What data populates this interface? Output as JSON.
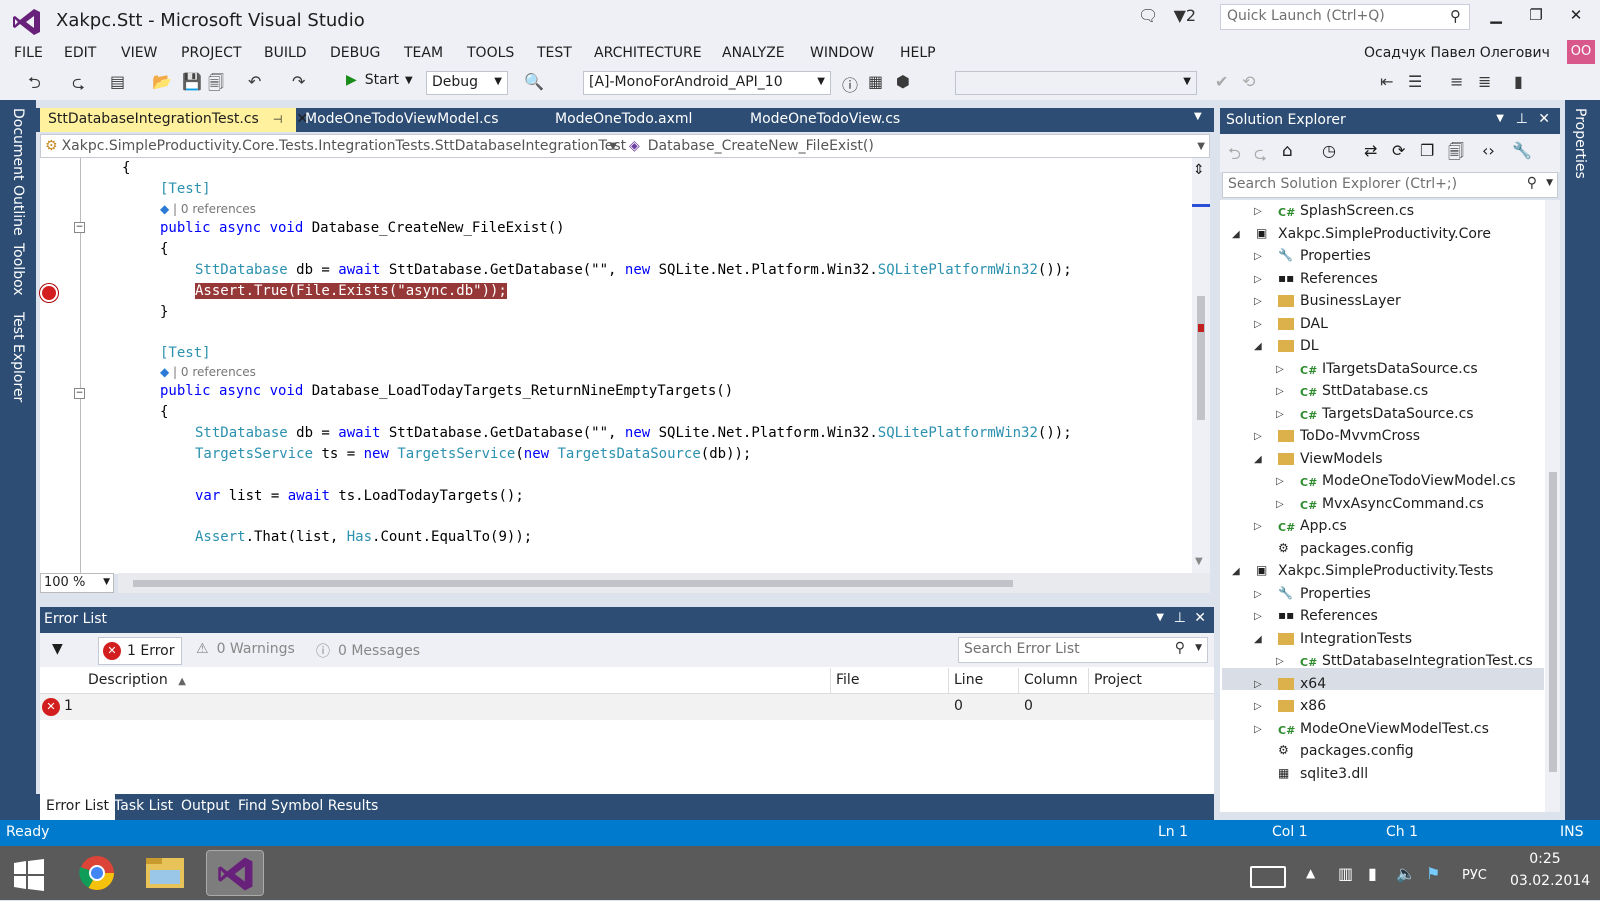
{
  "window": {
    "title": "Xakpc.Stt - Microsoft Visual Studio",
    "notif_count": "2",
    "quick_launch": "Quick Launch (Ctrl+Q)"
  },
  "menus": [
    "FILE",
    "EDIT",
    "VIEW",
    "PROJECT",
    "BUILD",
    "DEBUG",
    "TEAM",
    "TOOLS",
    "TEST",
    "ARCHITECTURE",
    "ANALYZE",
    "WINDOW",
    "HELP"
  ],
  "user": {
    "name": "Осадчук Павел Олегович",
    "initials": "OO"
  },
  "toolbar": {
    "start": "Start",
    "config": "Debug",
    "platform": "[A]-MonoForAndroid_API_10"
  },
  "left_rail": [
    "Document Outline",
    "Toolbox",
    "Test Explorer"
  ],
  "right_rail": [
    "Properties"
  ],
  "doc_tabs": [
    {
      "label": "SttDatabaseIntegrationTest.cs"
    },
    {
      "label": "ModeOneTodoViewModel.cs"
    },
    {
      "label": "ModeOneTodo.axml"
    },
    {
      "label": "ModeOneTodoView.cs"
    }
  ],
  "nav": {
    "class": "Xakpc.SimpleProductivity.Core.Tests.IntegrationTests.SttDatabaseIntegrationTest",
    "member": "Database_CreateNew_FileExist()"
  },
  "code": {
    "l1": "{",
    "l2": "[Test]",
    "ref": "0 references",
    "l3_kw": "public async void",
    "l3": " Database_CreateNew_FileExist()",
    "l4": "{",
    "l5_t": "SttDatabase",
    "l5_a": " db = ",
    "l5_kw": "await",
    "l5_b": " SttDatabase.GetDatabase(\"\", ",
    "l5_kw2": "new",
    "l5_c": " SQLite.Net.Platform.Win32.",
    "l5_t2": "SQLitePlatformWin32",
    "l5_d": "());",
    "l6": "Assert.True(File.Exists(\"async.db\"));",
    "l7": "}",
    "l8": "[Test]",
    "l9": " Database_LoadTodayTargets_ReturnNineEmptyTargets()",
    "l10": "{",
    "l11_t": "TargetsService",
    "l11_a": " ts = ",
    "l11_kw": "new",
    "l11_t2": " TargetsService",
    "l11_b": "(",
    "l11_kw2": "new",
    "l11_t3": " TargetsDataSource",
    "l11_c": "(db));",
    "l12_kw": "var",
    "l12": " list = ",
    "l12_kw2": "await",
    "l12_b": " ts.LoadTodayTargets();",
    "l13_t": "Assert",
    "l13_a": ".That(list, ",
    "l13_t2": "Has",
    "l13_b": ".Count.EqualTo(9));"
  },
  "zoom": "100 %",
  "error_list": {
    "title": "Error List",
    "errors": "1 Error",
    "warnings": "0 Warnings",
    "messages": "0 Messages",
    "search": "Search Error List",
    "columns": [
      "Description",
      "File",
      "Line",
      "Column",
      "Project"
    ],
    "row": {
      "num": "1",
      "line": "0",
      "column": "0"
    }
  },
  "bottom_tabs": [
    "Error List",
    "Task List",
    "Output",
    "Find Symbol Results"
  ],
  "solution_explorer": {
    "title": "Solution Explorer",
    "search": "Search Solution Explorer (Ctrl+;)",
    "items": [
      {
        "label": "SplashScreen.cs",
        "type": "cs"
      },
      {
        "label": "Xakpc.SimpleProductivity.Core",
        "type": "proj"
      },
      {
        "label": "Properties",
        "type": "wrench"
      },
      {
        "label": "References",
        "type": "refs"
      },
      {
        "label": "BusinessLayer",
        "type": "folder"
      },
      {
        "label": "DAL",
        "type": "folder"
      },
      {
        "label": "DL",
        "type": "folder"
      },
      {
        "label": "ITargetsDataSource.cs",
        "type": "cs"
      },
      {
        "label": "SttDatabase.cs",
        "type": "cs"
      },
      {
        "label": "TargetsDataSource.cs",
        "type": "cs"
      },
      {
        "label": "ToDo-MvvmCross",
        "type": "folder"
      },
      {
        "label": "ViewModels",
        "type": "folder"
      },
      {
        "label": "ModeOneTodoViewModel.cs",
        "type": "cs"
      },
      {
        "label": "MvxAsyncCommand.cs",
        "type": "cs"
      },
      {
        "label": "App.cs",
        "type": "cs"
      },
      {
        "label": "packages.config",
        "type": "config"
      },
      {
        "label": "Xakpc.SimpleProductivity.Tests",
        "type": "proj"
      },
      {
        "label": "Properties",
        "type": "wrench"
      },
      {
        "label": "References",
        "type": "refs"
      },
      {
        "label": "IntegrationTests",
        "type": "folder"
      },
      {
        "label": "SttDatabaseIntegrationTest.cs",
        "type": "cs"
      },
      {
        "label": "x64",
        "type": "folder"
      },
      {
        "label": "x86",
        "type": "folder"
      },
      {
        "label": "ModeOneViewModelTest.cs",
        "type": "cs"
      },
      {
        "label": "packages.config",
        "type": "config"
      },
      {
        "label": "sqlite3.dll",
        "type": "dll"
      }
    ]
  },
  "status": {
    "text": "Ready",
    "ln": "Ln 1",
    "col": "Col 1",
    "ch": "Ch 1",
    "ins": "INS"
  },
  "taskbar": {
    "lang": "РУС",
    "time": "0:25",
    "date": "03.02.2014"
  }
}
